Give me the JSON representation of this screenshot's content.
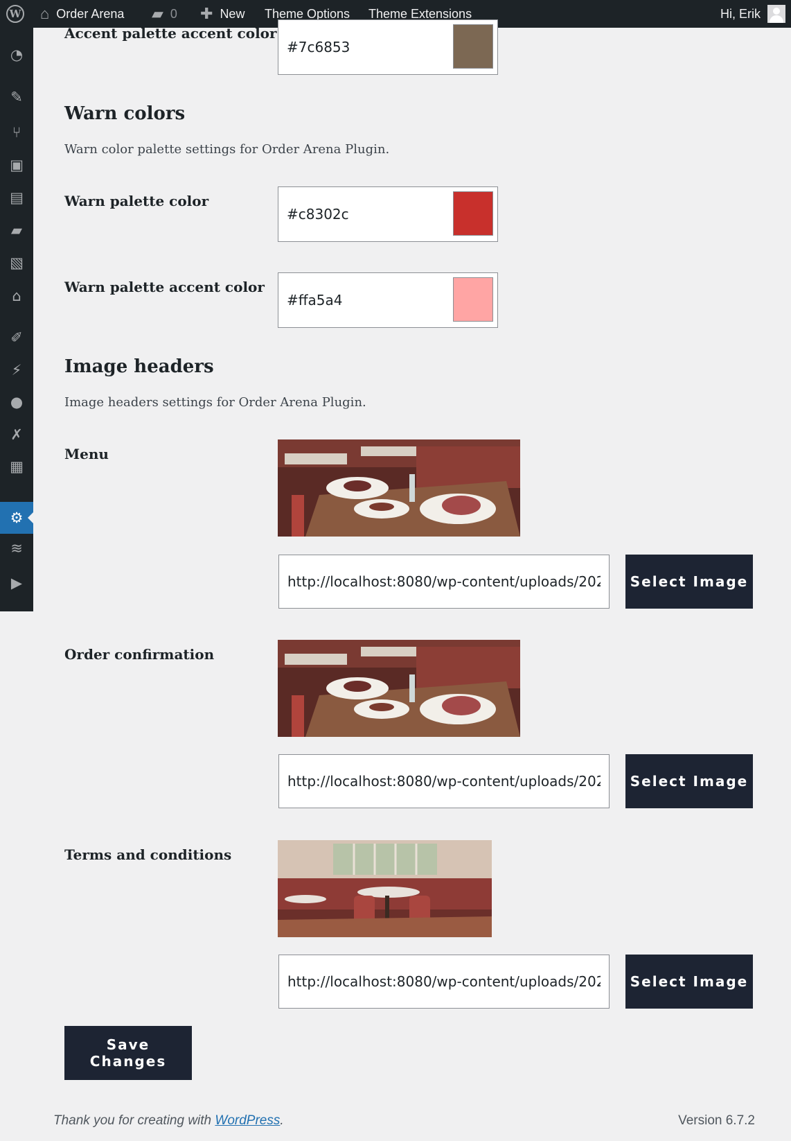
{
  "admin_bar": {
    "site_name": "Order Arena",
    "comments_count": "0",
    "new_label": "New",
    "theme_options_label": "Theme Options",
    "theme_extensions_label": "Theme Extensions",
    "greeting": "Hi, Erik"
  },
  "sidebar": {
    "icons": [
      "dashboard-icon",
      "pin-icon",
      "utensils-icon",
      "media-icon",
      "pages-icon",
      "comments-icon",
      "gallery-icon",
      "home-icon",
      "appearance-icon",
      "plugins-icon",
      "users-icon",
      "tools-icon",
      "updates-icon",
      "settings-icon",
      "layers-icon",
      "play-icon"
    ],
    "active": "settings-icon"
  },
  "accent": {
    "accent_label": "Accent palette accent color",
    "accent_value": "#7c6853"
  },
  "warn": {
    "heading": "Warn colors",
    "description": "Warn color palette settings for Order Arena Plugin.",
    "palette_label": "Warn palette color",
    "palette_value": "#c8302c",
    "accent_label": "Warn palette accent color",
    "accent_value": "#ffa5a4"
  },
  "image_headers": {
    "heading": "Image headers",
    "description": "Image headers settings for Order Arena Plugin.",
    "menu_label": "Menu",
    "menu_url": "http://localhost:8080/wp-content/uploads/202",
    "order_label": "Order confirmation",
    "order_url": "http://localhost:8080/wp-content/uploads/202",
    "terms_label": "Terms and conditions",
    "terms_url": "http://localhost:8080/wp-content/uploads/202",
    "select_label": "Select Image"
  },
  "save_label": "Save Changes",
  "footer": {
    "thanks_prefix": "Thank you for creating with ",
    "wordpress_link": "WordPress",
    "thanks_suffix": ".",
    "version": "Version 6.7.2"
  }
}
